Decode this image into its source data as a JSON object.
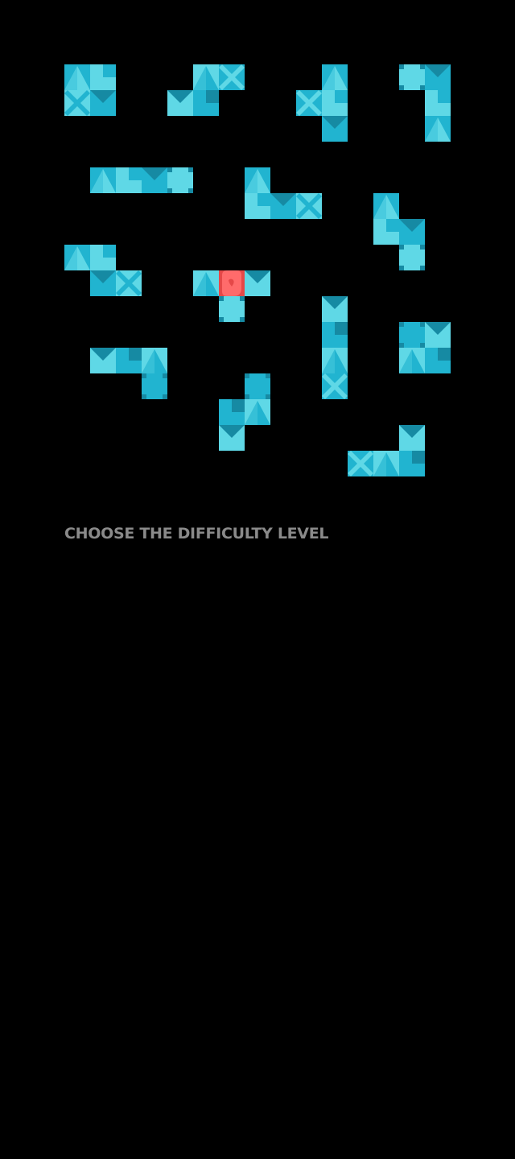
{
  "screen": {
    "background": "#000000",
    "prompt": "CHOOSE THE DIFFICULTY LEVEL",
    "prompt_color": "#8a8a8a"
  },
  "palette": {
    "light": "#5fd8e6",
    "mid": "#21b4d0",
    "dark": "#168aa3",
    "heart_main": "#ff6b6b",
    "heart_dark": "#e54848"
  },
  "tile_icons": {
    "triangle": "triangle-up-icon",
    "chevron": "chevron-down-icon",
    "cross": "cross-icon",
    "plus": "plus-icon",
    "corner": "corner-square-icon",
    "heart": "heart-icon"
  }
}
